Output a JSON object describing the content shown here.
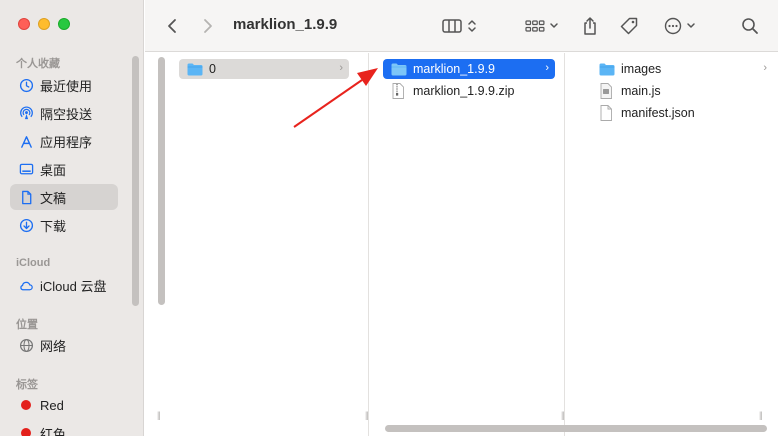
{
  "window": {
    "title": "marklion_1.9.9"
  },
  "sidebar": {
    "favorites_header": "个人收藏",
    "favorites": [
      {
        "label": "最近使用",
        "icon": "clock-icon"
      },
      {
        "label": "隔空投送",
        "icon": "airdrop-icon"
      },
      {
        "label": "应用程序",
        "icon": "apps-icon"
      },
      {
        "label": "桌面",
        "icon": "desktop-icon"
      },
      {
        "label": "文稿",
        "icon": "document-icon",
        "active": true
      },
      {
        "label": "下载",
        "icon": "download-icon"
      }
    ],
    "icloud_header": "iCloud",
    "icloud": [
      {
        "label": "iCloud 云盘",
        "icon": "cloud-icon"
      }
    ],
    "locations_header": "位置",
    "locations": [
      {
        "label": "网络",
        "icon": "network-icon"
      }
    ],
    "tags_header": "标签",
    "tags": [
      {
        "label": "Red",
        "color": "#e3201b"
      },
      {
        "label": "红色",
        "color": "#e3201b"
      }
    ]
  },
  "columns": {
    "col1": [
      {
        "name": "0",
        "type": "folder",
        "selected": "gray"
      }
    ],
    "col2": [
      {
        "name": "marklion_1.9.9",
        "type": "folder",
        "selected": "blue"
      },
      {
        "name": "marklion_1.9.9.zip",
        "type": "zip"
      }
    ],
    "col3": [
      {
        "name": "images",
        "type": "folder"
      },
      {
        "name": "main.js",
        "type": "js"
      },
      {
        "name": "manifest.json",
        "type": "file"
      }
    ]
  },
  "colors": {
    "accent": "#1c6ef2",
    "folder": "#5bb5f5",
    "arrow": "#e8231d"
  }
}
